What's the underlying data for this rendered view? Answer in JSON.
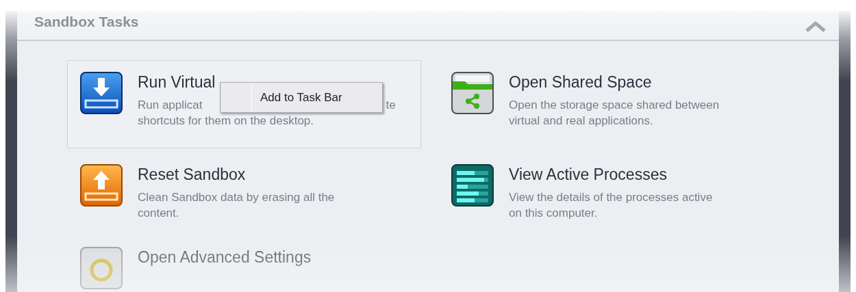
{
  "panel": {
    "title": "Sandbox Tasks",
    "expanded": true
  },
  "tasks": [
    {
      "kind": "run",
      "title": "Run Virtual",
      "highlighted": true,
      "dimmed": false,
      "description_lines": [
        [
          "Run applicat",
          "te"
        ],
        [
          "shortcuts for them on the desktop."
        ]
      ]
    },
    {
      "kind": "shared",
      "title": "Open Shared Space",
      "highlighted": false,
      "dimmed": false,
      "description_lines": [
        [
          "Open the storage space shared between"
        ],
        [
          "virtual and real applications."
        ]
      ]
    },
    {
      "kind": "reset",
      "title": "Reset Sandbox",
      "highlighted": false,
      "dimmed": false,
      "description_lines": [
        [
          "Clean Sandbox data by erasing all the"
        ],
        [
          "content."
        ]
      ]
    },
    {
      "kind": "processes",
      "title": "View Active Processes",
      "highlighted": false,
      "dimmed": false,
      "description_lines": [
        [
          "View the details of the processes active"
        ],
        [
          "on this computer."
        ]
      ]
    },
    {
      "kind": "settings",
      "title": "Open Advanced Settings",
      "highlighted": false,
      "dimmed": true
    }
  ],
  "context_menu": {
    "items": [
      "Add to Task Bar"
    ]
  }
}
